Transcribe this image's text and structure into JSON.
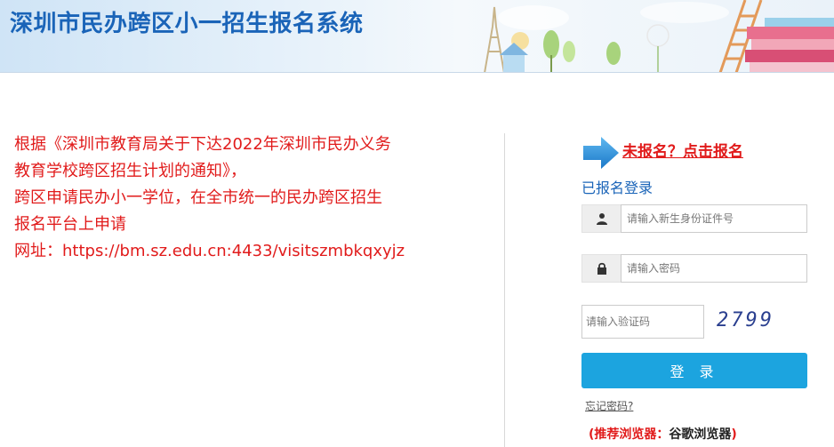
{
  "header": {
    "title": "深圳市民办跨区小一招生报名系统"
  },
  "notice": {
    "lines": [
      "根据《深圳市教育局关于下达2022年深圳市民办义务",
      "教育学校跨区招生计划的通知》，",
      "跨区申请民办小一学位，在全市统一的民办跨区招生",
      "报名平台上申请",
      "网址：https://bm.sz.edu.cn:4433/visitszmbkqxyjz"
    ]
  },
  "login": {
    "register_link": "未报名？点击报名",
    "title": "已报名登录",
    "id_placeholder": "请输入新生身份证件号",
    "password_placeholder": "请输入密码",
    "captcha_placeholder": "请输入验证码",
    "captcha_text": "2799",
    "login_button": "登 录",
    "forgot_password": "忘记密码?",
    "browser_tip_prefix": "(推荐浏览器：",
    "browser_tip_browser": "谷歌浏览器",
    "browser_tip_suffix": ")"
  },
  "colors": {
    "brand_blue": "#1a64b8",
    "notice_red": "#e11b1b",
    "button_blue": "#1ca4df"
  },
  "icons": {
    "header_art": "school-illustration",
    "arrow": "arrow-right-icon",
    "user": "user-icon",
    "lock": "lock-icon"
  }
}
